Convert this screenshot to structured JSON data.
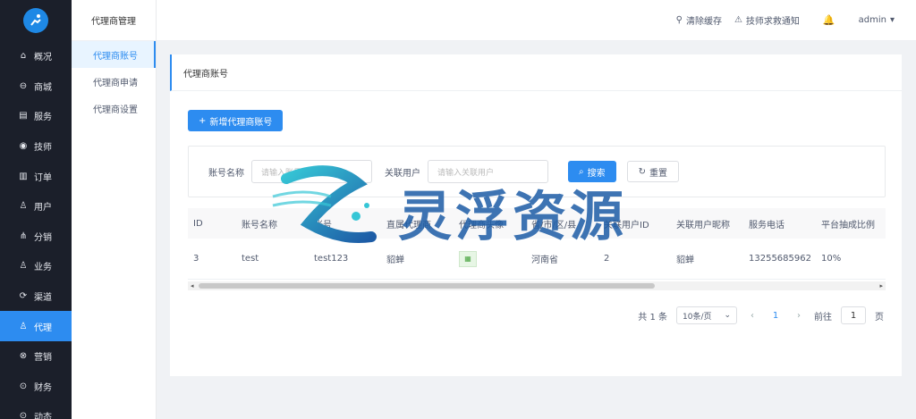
{
  "sidebar": {
    "logo_alt": "logo",
    "items": [
      {
        "icon": "home-icon",
        "glyph": "⌂",
        "label": "概况"
      },
      {
        "icon": "store-icon",
        "glyph": "⊖",
        "label": "商城"
      },
      {
        "icon": "service-icon",
        "glyph": "▤",
        "label": "服务"
      },
      {
        "icon": "technician-icon",
        "glyph": "◉",
        "label": "技师"
      },
      {
        "icon": "order-icon",
        "glyph": "▥",
        "label": "订单"
      },
      {
        "icon": "user-icon",
        "glyph": "♙",
        "label": "用户"
      },
      {
        "icon": "distribution-icon",
        "glyph": "⋔",
        "label": "分销"
      },
      {
        "icon": "business-icon",
        "glyph": "♙",
        "label": "业务"
      },
      {
        "icon": "channel-icon",
        "glyph": "⟳",
        "label": "渠道"
      },
      {
        "icon": "agent-icon",
        "glyph": "♙",
        "label": "代理",
        "active": true
      },
      {
        "icon": "marketing-icon",
        "glyph": "⊗",
        "label": "营销"
      },
      {
        "icon": "finance-icon",
        "glyph": "⊙",
        "label": "财务"
      },
      {
        "icon": "more-icon",
        "glyph": "⊙",
        "label": "动态"
      }
    ]
  },
  "subsidebar": {
    "title": "代理商管理",
    "items": [
      {
        "label": "代理商账号",
        "active": true
      },
      {
        "label": "代理商申请"
      },
      {
        "label": "代理商设置"
      }
    ]
  },
  "header": {
    "clear_cache": "清除缓存",
    "tech_notice": "技师求救通知",
    "user": "admin"
  },
  "card": {
    "title": "代理商账号",
    "add_button": "新增代理商账号"
  },
  "search": {
    "account_label": "账号名称",
    "account_placeholder": "请输入账号名称",
    "related_label": "关联用户",
    "related_placeholder": "请输入关联用户",
    "search_button": "搜索",
    "reset_button": "重置"
  },
  "table": {
    "headers": [
      "ID",
      "账号名称",
      "账号",
      "直属代理商",
      "代理商头像",
      "省/市/区/县",
      "关联用户ID",
      "关联用户昵称",
      "服务电话",
      "平台抽成比例"
    ],
    "rows": [
      {
        "id": "3",
        "name": "test",
        "account": "test123",
        "direct": "貂蝉",
        "region": "河南省",
        "uid": "2",
        "nickname": "貂蝉",
        "phone": "13255685962",
        "ratio": "10%"
      }
    ]
  },
  "pager": {
    "total": "共 1 条",
    "page_size": "10条/页",
    "current": "1",
    "goto_label": "前往",
    "goto_value": "1",
    "page_suffix": "页"
  },
  "watermark": {
    "text": "灵浮资源"
  }
}
